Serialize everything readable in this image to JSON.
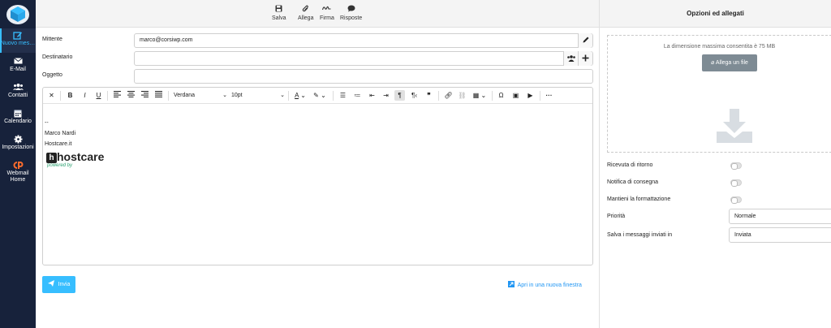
{
  "nav": {
    "items": [
      {
        "label": "Nuovo mes…",
        "icon": "edit-icon"
      },
      {
        "label": "E-Mail",
        "icon": "envelope-icon"
      },
      {
        "label": "Contatti",
        "icon": "users-icon"
      },
      {
        "label": "Calendario",
        "icon": "calendar-icon"
      },
      {
        "label": "Impostazioni",
        "icon": "gear-icon"
      },
      {
        "label_line1": "Webmail",
        "label_line2": "Home",
        "icon": "cpanel-icon"
      }
    ]
  },
  "toolbar": {
    "save": "Salva",
    "attach": "Allega",
    "signature": "Firma",
    "responses": "Risposte"
  },
  "compose": {
    "from_label": "Mittente",
    "from_value": "marco@corsiwp.com",
    "to_label": "Destinatario",
    "to_value": "",
    "subject_label": "Oggetto",
    "subject_value": ""
  },
  "editor": {
    "font": "Verdana",
    "size": "10pt",
    "body": {
      "sig_sep": "--",
      "sig_name": "Marco Nardi",
      "sig_site": "Hostcare.it",
      "logo_text": "hostcare",
      "logo_mark": "h",
      "logo_tag": "powered by"
    }
  },
  "actions": {
    "send": "Invia",
    "new_window": "Apri in una nuova finestra"
  },
  "panel": {
    "title": "Opzioni ed allegati",
    "max_size": "La dimensione massima consentita è 75 MB",
    "attach_button": "Allega un file",
    "options": {
      "return_receipt": "Ricevuta di ritorno",
      "delivery_notice": "Notifica di consegna",
      "keep_format": "Mantieni la formattazione",
      "priority_label": "Priorità",
      "priority_value": "Normale",
      "save_sent_label": "Salva i messaggi inviati in",
      "save_sent_value": "Inviata"
    }
  },
  "colors": {
    "sidebar": "#17223b",
    "accent": "#37beff",
    "link": "#2196f3"
  }
}
